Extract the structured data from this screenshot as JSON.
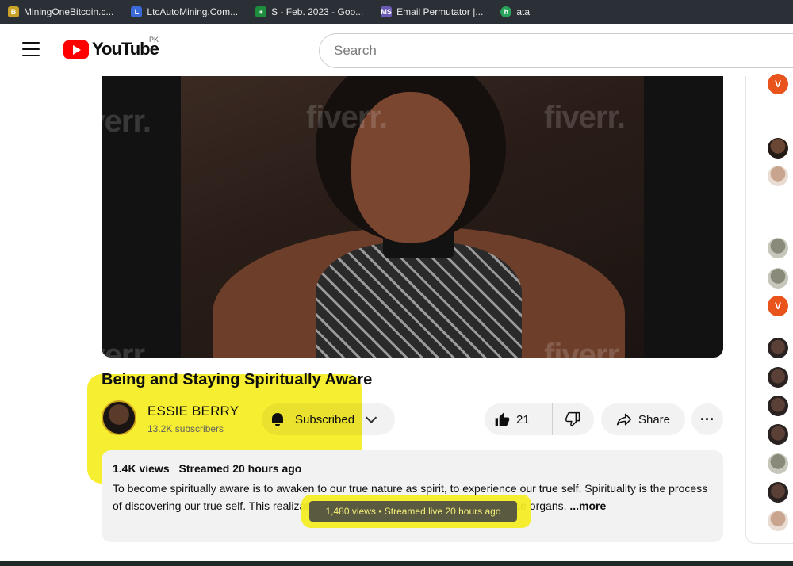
{
  "bookmarks": [
    {
      "label": "MiningOneBitcoin.c...",
      "icon": "mining-favicon",
      "color": "#c9a227"
    },
    {
      "label": "LtcAutoMining.Com...",
      "icon": "ltc-favicon",
      "color": "#3b6ad6"
    },
    {
      "label": "S - Feb. 2023 - Goo...",
      "icon": "sheets-favicon",
      "color": "#1e8e3e"
    },
    {
      "label": "Email Permutator |...",
      "icon": "email-permutator-favicon",
      "color": "#6b5bb5"
    },
    {
      "label": "ata",
      "icon": "ata-favicon",
      "color": "#2aa35a"
    }
  ],
  "bookmark_icon_letters": [
    "B",
    "L",
    "+",
    "MS",
    "h"
  ],
  "masthead": {
    "logo_text": "YouTube",
    "country_code": "PK",
    "search_placeholder": "Search"
  },
  "player": {
    "watermark": "fiverr."
  },
  "video": {
    "title": "Being and Staying Spiritually Aware",
    "channel_name": "ESSIE BERRY",
    "subscribers": "13.2K subscribers",
    "subscribe_label": "Subscribed",
    "like_count": "21",
    "share_label": "Share",
    "more_label": "···"
  },
  "description": {
    "views": "1.4K views",
    "streamed": "Streamed 20 hours ago",
    "text": "To become spiritually aware is to awaken to our true nature as spirit, to experience our true self. Spirituality is the process of discovering our true self. This realization is possible only through our bodily sense organs. ",
    "more_label": "...more",
    "tooltip": "1,480 views • Streamed live 20 hours ago"
  },
  "colors": {
    "highlight": "#f5ed1f",
    "youtube_red": "#ff0000",
    "avatar_v": "#e8541c"
  },
  "rail": {
    "v_letter": "V"
  }
}
